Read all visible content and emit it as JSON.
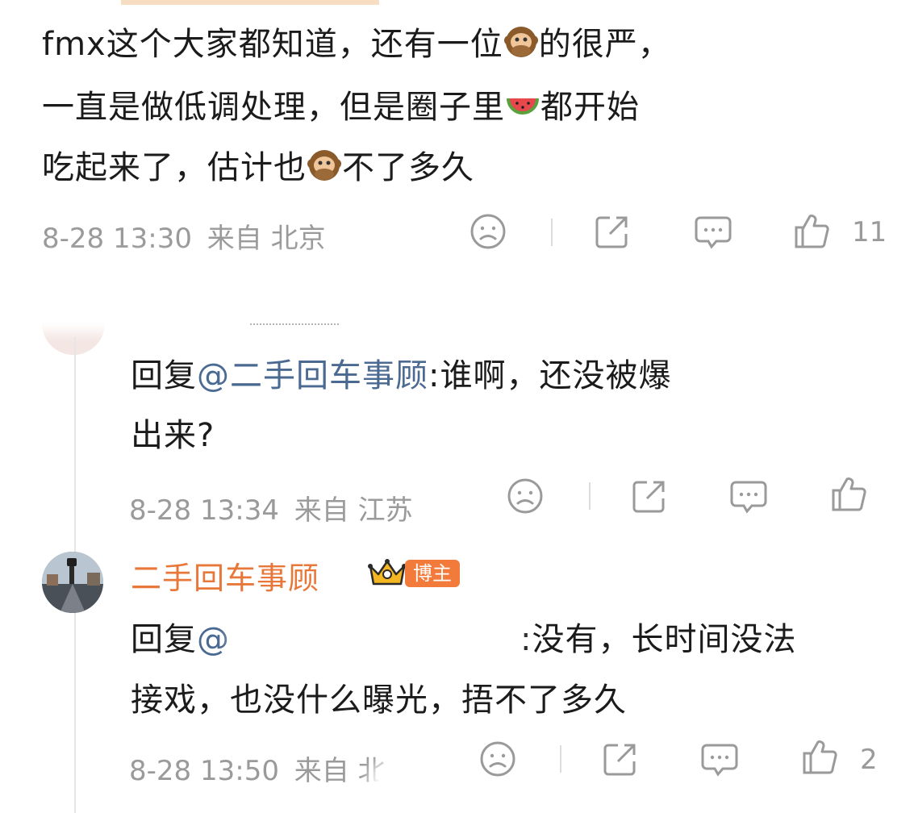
{
  "comment1": {
    "lines": [
      [
        "fmx这个大家都知道，还有一位",
        "的很严，"
      ],
      [
        "一直是做低调处理，但是圈子里",
        "都开始"
      ],
      [
        "吃起来了，估计也",
        "不了多久"
      ]
    ],
    "date": "8-28 13:30",
    "from": "来自 北京",
    "likes": "11"
  },
  "reply1": {
    "prefix": "回复",
    "mention": "@二手回车事顾",
    "text1": ":谁啊，还没被爆",
    "text2": "出来?",
    "date": "8-28 13:34",
    "from": "来自 江苏"
  },
  "reply2": {
    "author": "二手回车事顾",
    "badge": "博主",
    "prefix": "回复",
    "mention": "@",
    "text1": ":没有，长时间没法",
    "text2": "接戏，也没什么曝光，捂不了多久",
    "date": "8-28 13:50",
    "from": "来自 北",
    "likes": "2"
  },
  "icons": [
    "sad-face-icon",
    "share-icon",
    "comment-icon",
    "like-icon",
    "monkey-emoji",
    "watermelon-emoji",
    "crown-icon"
  ]
}
